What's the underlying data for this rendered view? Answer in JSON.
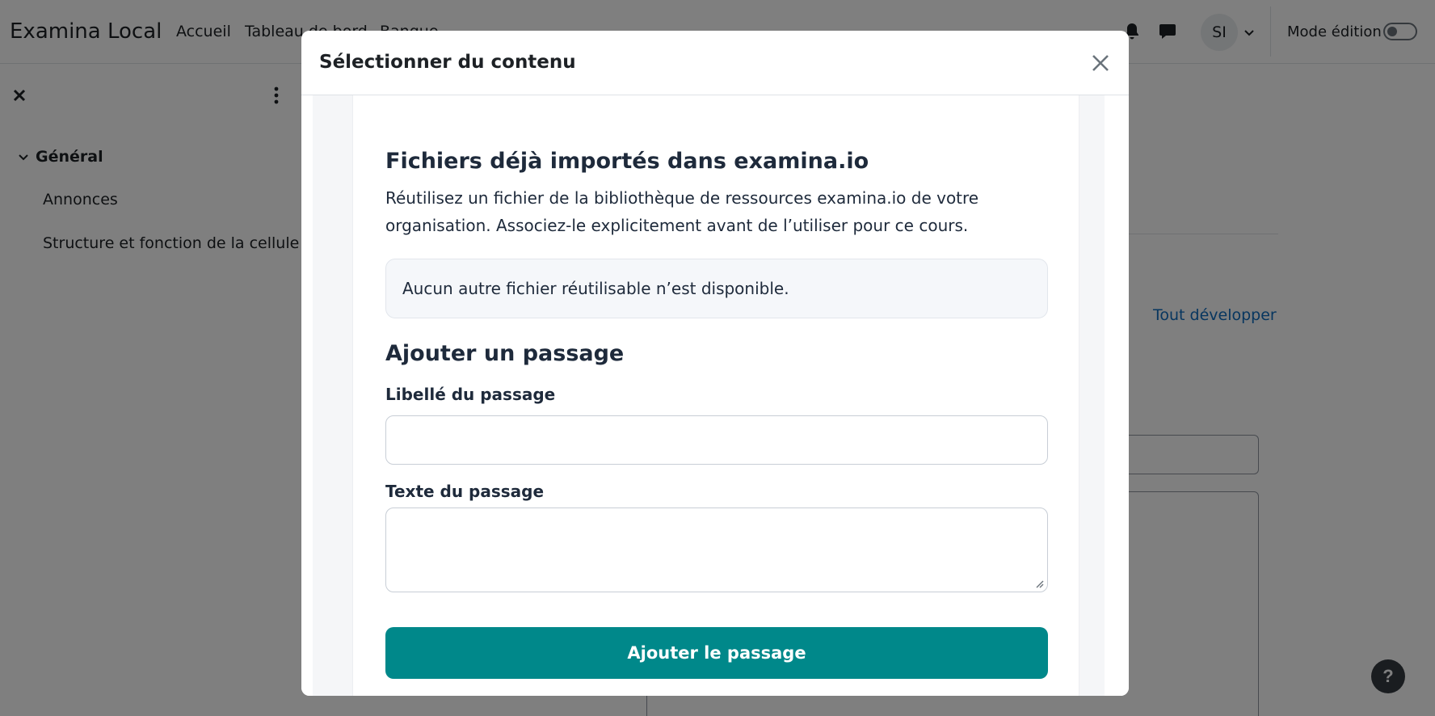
{
  "header": {
    "site_name": "Examina Local",
    "nav": [
      "Accueil",
      "Tableau de bord",
      "Banque"
    ],
    "avatar_initials": "SI",
    "edit_mode_label": "Mode édition",
    "edit_mode_on": false
  },
  "drawer": {
    "section": "Général",
    "items": [
      "Annonces",
      "Structure et fonction de la cellule"
    ]
  },
  "page": {
    "expand_all": "Tout développer",
    "help": "?"
  },
  "modal": {
    "title": "Sélectionner du contenu",
    "reuse": {
      "title": "Fichiers déjà importés dans examina.io",
      "description": "Réutilisez un fichier de la bibliothèque de ressources examina.io de votre organisation. Associez-le explicitement avant de l’utiliser pour ce cours.",
      "empty_message": "Aucun autre fichier réutilisable n’est disponible."
    },
    "passage": {
      "title": "Ajouter un passage",
      "label_field": "Libellé du passage",
      "label_value": "",
      "text_field": "Texte du passage",
      "text_value": "",
      "submit": "Ajouter le passage"
    }
  },
  "colors": {
    "accent": "#00888a",
    "link": "#0f6cbf"
  }
}
